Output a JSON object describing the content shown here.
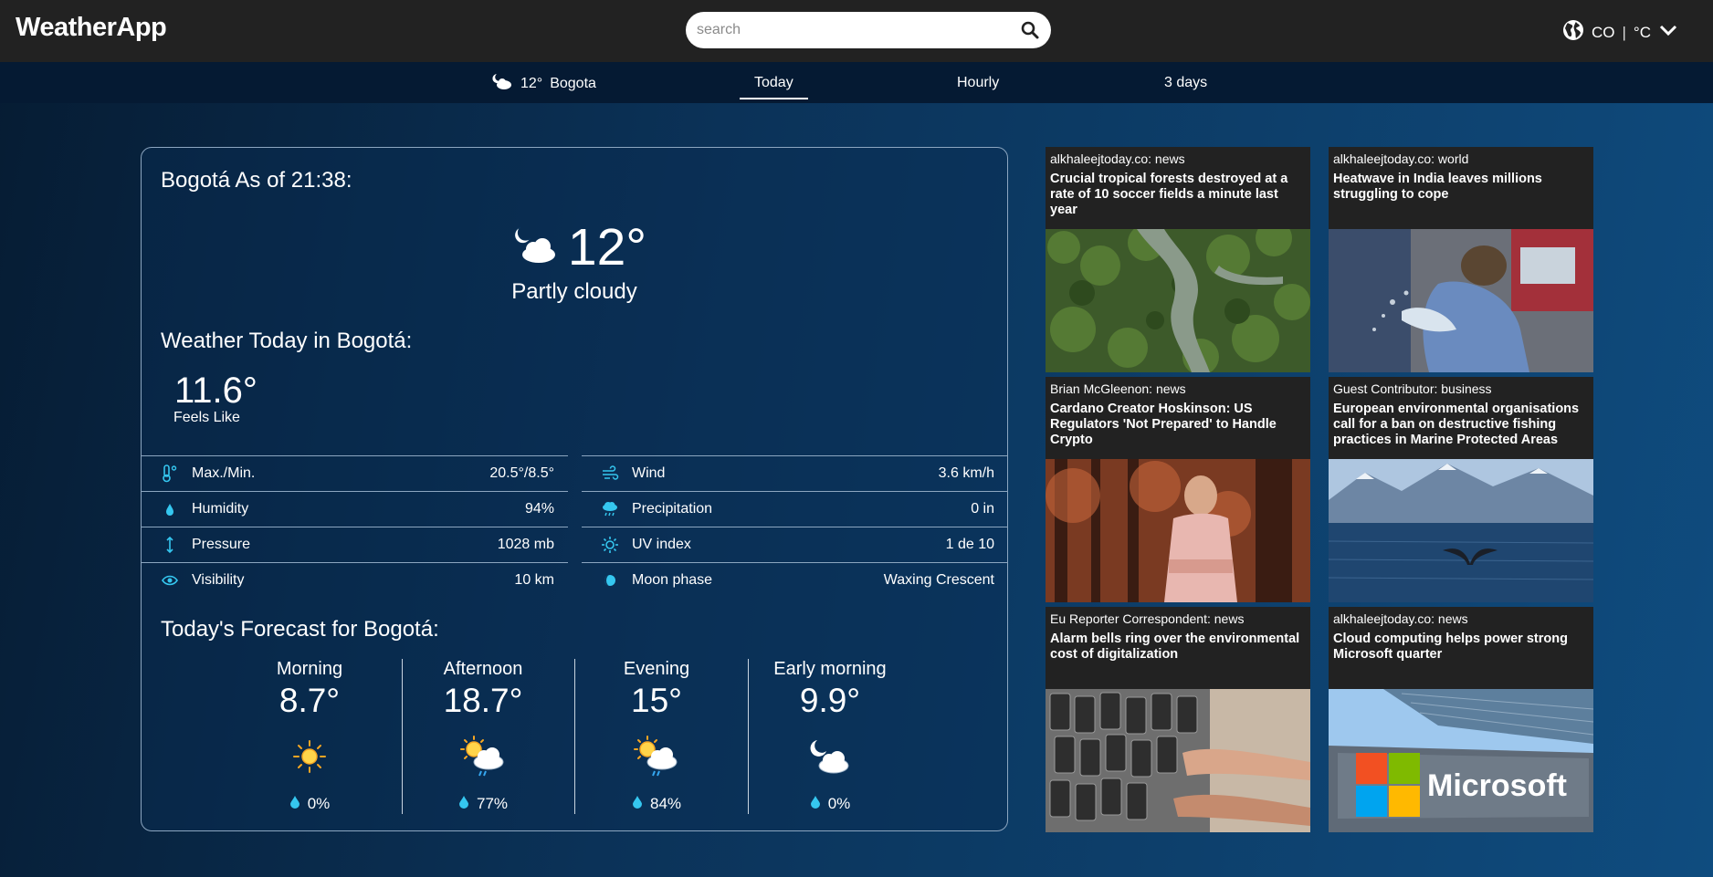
{
  "app": {
    "title": "WeatherApp"
  },
  "search": {
    "placeholder": "search"
  },
  "locale": {
    "country": "CO",
    "unit": "°C"
  },
  "nav": {
    "current_temp": "12°",
    "current_city": "Bogota",
    "tabs": [
      "Today",
      "Hourly",
      "3 days"
    ],
    "active_tab": "Today"
  },
  "current": {
    "title": "Bogotá As of 21:38:",
    "temp": "12°",
    "condition": "Partly cloudy",
    "condition_icon": "moon-cloud-icon"
  },
  "today": {
    "title": "Weather Today in Bogotá:",
    "feels_value": "11.6°",
    "feels_label": "Feels Like",
    "stats_left": [
      {
        "icon": "thermometer-icon",
        "label": "Max./Min.",
        "value": "20.5°/8.5°"
      },
      {
        "icon": "droplet-icon",
        "label": "Humidity",
        "value": "94%"
      },
      {
        "icon": "pressure-icon",
        "label": "Pressure",
        "value": "1028 mb"
      },
      {
        "icon": "eye-icon",
        "label": "Visibility",
        "value": "10 km"
      }
    ],
    "stats_right": [
      {
        "icon": "wind-icon",
        "label": "Wind",
        "value": "3.6 km/h"
      },
      {
        "icon": "rain-cloud-icon",
        "label": "Precipitation",
        "value": "0 in"
      },
      {
        "icon": "sun-uv-icon",
        "label": "UV index",
        "value": "1 de 10"
      },
      {
        "icon": "moon-phase-icon",
        "label": "Moon phase",
        "value": "Waxing Crescent"
      }
    ]
  },
  "forecast": {
    "title": "Today's Forecast for Bogotá:",
    "periods": [
      {
        "name": "Morning",
        "temp": "8.7°",
        "icon": "sun-icon",
        "precip": "0%"
      },
      {
        "name": "Afternoon",
        "temp": "18.7°",
        "icon": "sun-cloud-rain-icon",
        "precip": "77%"
      },
      {
        "name": "Evening",
        "temp": "15°",
        "icon": "sun-cloud-rain-icon",
        "precip": "84%"
      },
      {
        "name": "Early morning",
        "temp": "9.9°",
        "icon": "moon-cloud-icon",
        "precip": "0%"
      }
    ]
  },
  "news": [
    {
      "source": "alkhaleejtoday.co: news",
      "title": "Crucial tropical forests destroyed at a rate of 10 soccer fields a minute last year",
      "image": "forest-river-aerial"
    },
    {
      "source": "alkhaleejtoday.co: world",
      "title": "Heatwave in India leaves millions struggling to cope",
      "image": "man-splashing-water"
    },
    {
      "source": "Brian McGleenon: news",
      "title": "Cardano Creator Hoskinson: US Regulators 'Not Prepared' to Handle Crypto",
      "image": "man-portrait-trees"
    },
    {
      "source": "Guest Contributor: business",
      "title": "European environmental organisations call for a ban on destructive fishing practices in Marine Protected Areas",
      "image": "whale-tail-mountains"
    },
    {
      "source": "Eu Reporter Correspondent: news",
      "title": "Alarm bells ring over the environmental cost of digitalization",
      "image": "pile-of-old-phones"
    },
    {
      "source": "alkhaleejtoday.co: news",
      "title": "Cloud computing helps power strong Microsoft quarter",
      "image": "microsoft-sign-building"
    }
  ],
  "news_logo": {
    "wordmark": "Microsoft"
  }
}
